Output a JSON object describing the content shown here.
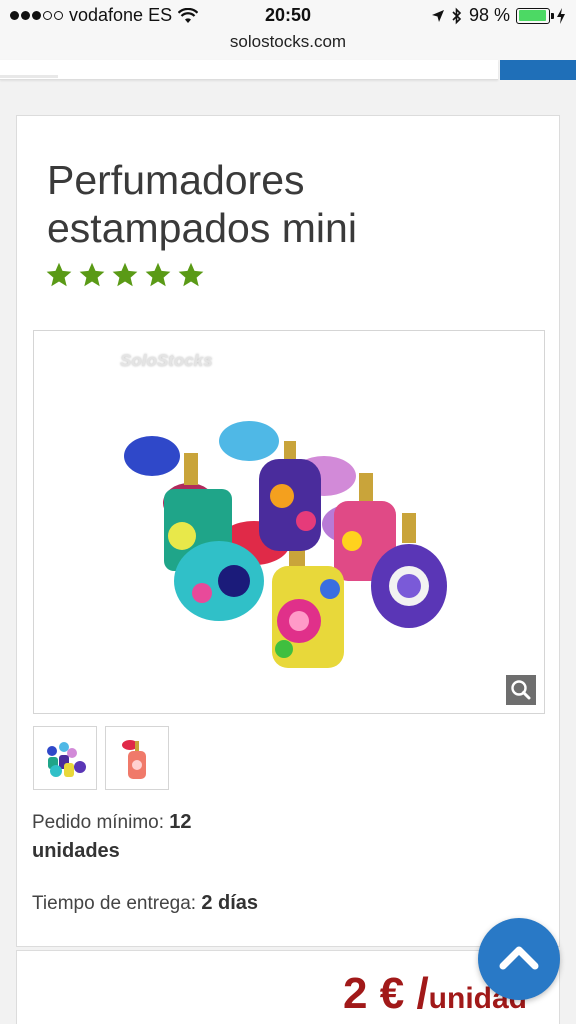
{
  "status_bar": {
    "carrier": "vodafone ES",
    "time": "20:50",
    "battery": "98 %"
  },
  "browser": {
    "url": "solostocks.com"
  },
  "product": {
    "title": "Perfumadores estampados mini",
    "rating": 5,
    "watermark": "SoloStocks",
    "min_order_label": "Pedido mínimo:",
    "min_order_value": "12 unidades",
    "delivery_label": "Tiempo de entrega:",
    "delivery_value": "2 días",
    "price": "2 € /",
    "price_unit": "unidad"
  },
  "colors": {
    "star": "#5a9a16",
    "price": "#a11919",
    "fab": "#2979c6",
    "header_accent": "#1f6fb8"
  },
  "icons": [
    "wifi-icon",
    "location-arrow-icon",
    "bluetooth-icon",
    "battery-icon",
    "charging-icon",
    "star-icon",
    "zoom-icon",
    "chevron-up-icon"
  ]
}
